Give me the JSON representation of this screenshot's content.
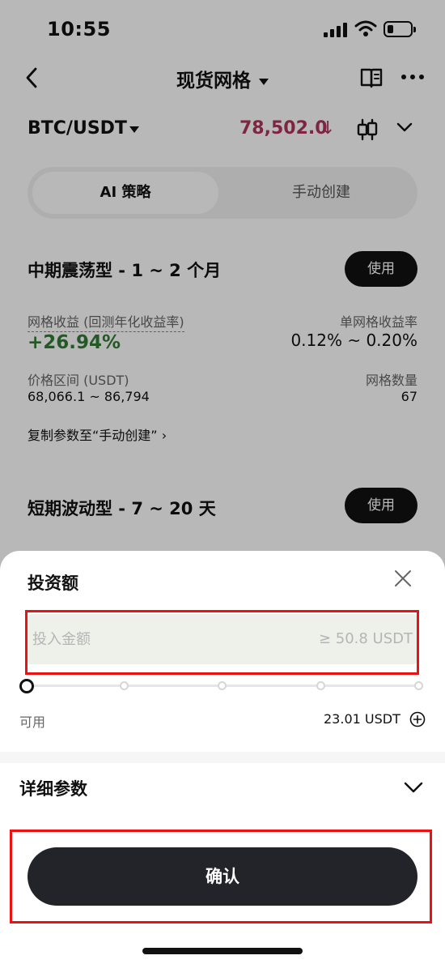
{
  "status": {
    "time": "10:55"
  },
  "header": {
    "title": "现货网格"
  },
  "pair": {
    "name": "BTC/USDT",
    "price": "78,502.0",
    "price_arrow": "↓"
  },
  "segment": {
    "active": "AI 策略",
    "other": "手动创建"
  },
  "cards": [
    {
      "title": "中期震荡型 - 1 ~ 2 个月",
      "use_label": "使用",
      "yield_label": "网格收益 (回测年化收益率)",
      "yield_value": "+26.94%",
      "per_grid_label": "单网格收益率",
      "per_grid_value": "0.12% ~ 0.20%",
      "range_label": "价格区间 (USDT)",
      "range_value": "68,066.1 ~ 86,794",
      "count_label": "网格数量",
      "count_value": "67",
      "copy_link": "复制参数至“手动创建”"
    },
    {
      "title": "短期波动型 - 7 ~ 20 天",
      "use_label": "使用"
    }
  ],
  "sheet": {
    "title": "投资额",
    "input_placeholder": "投入金额",
    "input_min": "≥ 50.8 USDT",
    "available_label": "可用",
    "available_value": "23.01 USDT",
    "detail_label": "详细参数",
    "confirm_label": "确认"
  },
  "colors": {
    "price_down": "#b0345a",
    "yield_up": "#2e7d32",
    "highlight": "#e11111"
  }
}
